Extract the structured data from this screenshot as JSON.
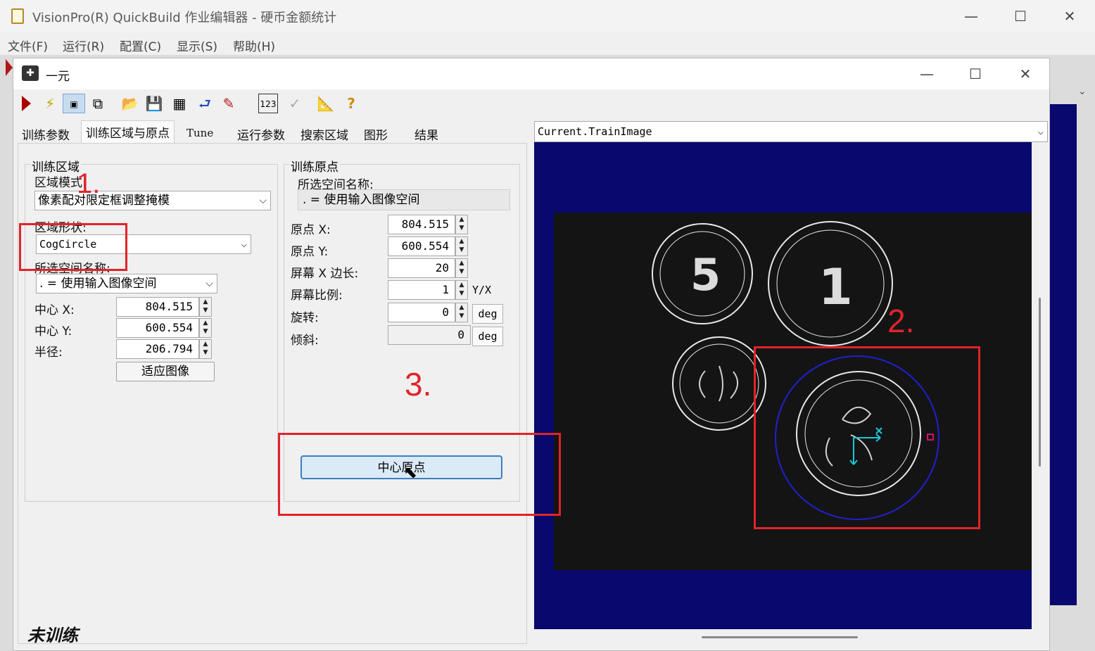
{
  "outer_window": {
    "title": "VisionPro(R) QuickBuild 作业编辑器 - 硬币金额统计",
    "minimize": "—",
    "maximize": "☐",
    "close": "✕"
  },
  "menu": [
    "文件(F)",
    "运行(R)",
    "配置(C)",
    "显示(S)",
    "帮助(H)"
  ],
  "inner_window": {
    "title": "一元",
    "minimize": "—",
    "maximize": "☐",
    "close": "✕"
  },
  "tabs": [
    "训练参数",
    "训练区域与原点",
    "Tune",
    "运行参数",
    "搜索区域",
    "图形",
    "结果"
  ],
  "train_region": {
    "group_title": "训练区域",
    "mode_label": "区域模式:",
    "mode_value": "像素配对限定框调整掩模",
    "shape_label": "区域形状:",
    "shape_value": "CogCircle",
    "space_label": "所选空间名称:",
    "space_value": ". = 使用输入图像空间",
    "center_x_label": "中心 X:",
    "center_x": "804.515",
    "center_y_label": "中心 Y:",
    "center_y": "600.554",
    "radius_label": "半径:",
    "radius": "206.794",
    "fit_button": "适应图像"
  },
  "train_origin": {
    "group_title": "训练原点",
    "space_label": "所选空间名称:",
    "space_value": ". = 使用输入图像空间",
    "origin_x_label": "原点 X:",
    "origin_x": "804.515",
    "origin_y_label": "原点 Y:",
    "origin_y": "600.554",
    "screen_x_label": "屏幕 X 边长:",
    "screen_x": "20",
    "screen_ratio_label": "屏幕比例:",
    "screen_ratio": "1",
    "ratio_unit": "Y/X",
    "rotate_label": "旋转:",
    "rotate": "0",
    "skew_label": "倾斜:",
    "skew": "0",
    "deg": "deg",
    "center_origin_button": "中心原点"
  },
  "status_text": "未训练",
  "image_view": {
    "selector": "Current.TrainImage"
  },
  "annotations": [
    "1.",
    "2.",
    "3."
  ],
  "colors": {
    "display_bg": "#08086e",
    "image_bg": "#141414",
    "region_circle": "#2020d0",
    "origin_axes": "#18c8d8",
    "annotation_red": "#e0242b"
  }
}
